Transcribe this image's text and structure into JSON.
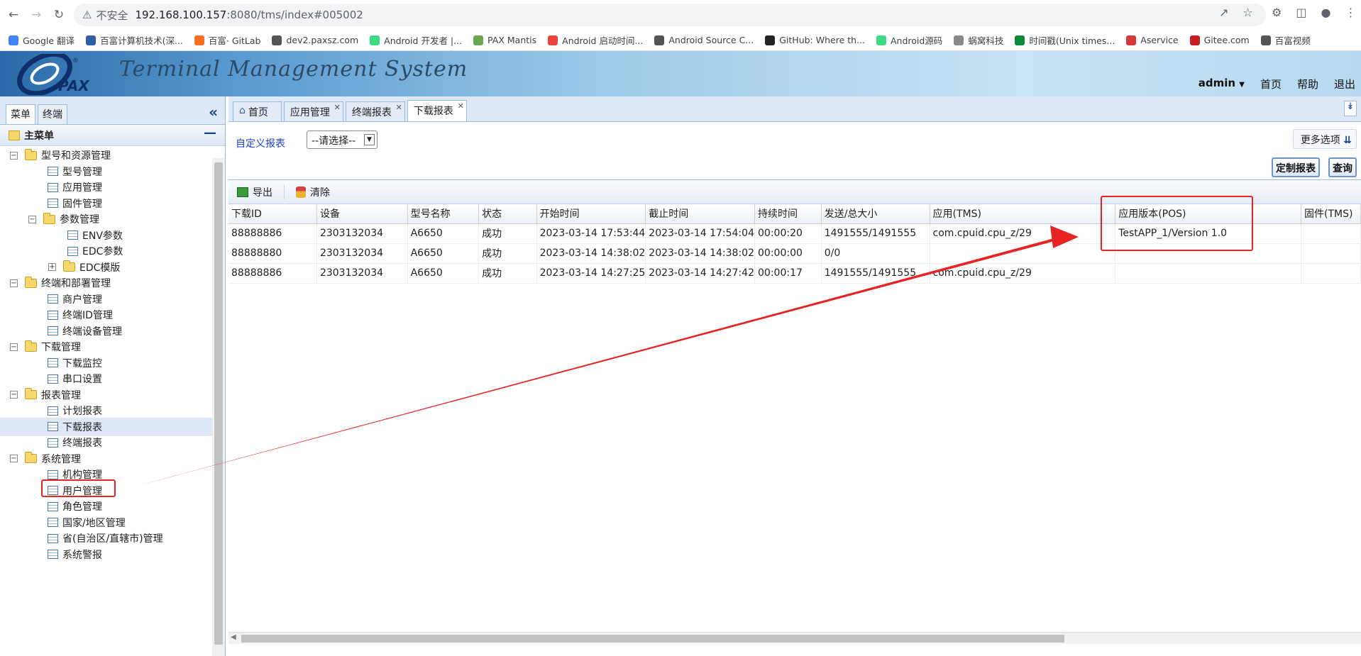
{
  "browser": {
    "url_security": "不安全",
    "url_host": "192.168.100.157",
    "url_path": ":8080/tms/index#005002",
    "bookmarks": [
      {
        "label": "Google 翻译",
        "color": "#4285f4"
      },
      {
        "label": "百富计算机技术(深...",
        "color": "#2c5fa8"
      },
      {
        "label": "百富· GitLab",
        "color": "#fc6d26"
      },
      {
        "label": "dev2.paxsz.com",
        "color": "#555555"
      },
      {
        "label": "Android 开发者 |...",
        "color": "#3ddc84"
      },
      {
        "label": "PAX Mantis",
        "color": "#6aa84f"
      },
      {
        "label": "Android 启动时间...",
        "color": "#e8453c"
      },
      {
        "label": "Android Source C...",
        "color": "#555555"
      },
      {
        "label": "GitHub: Where th...",
        "color": "#222222"
      },
      {
        "label": "Android源码",
        "color": "#3ddc84"
      },
      {
        "label": "蜗窝科技",
        "color": "#888888"
      },
      {
        "label": "时间戳(Unix times...",
        "color": "#0a8a3a"
      },
      {
        "label": "Aservice",
        "color": "#d23a3a"
      },
      {
        "label": "Gitee.com",
        "color": "#c71d23"
      },
      {
        "label": "百富视频",
        "color": "#555555"
      }
    ]
  },
  "app": {
    "title": "Terminal Management System",
    "logo_text": "PAX",
    "user": "admin",
    "links": {
      "home": "首页",
      "help": "帮助",
      "logout": "退出"
    }
  },
  "sidebar": {
    "tab_menu": "菜单",
    "tab_terminal": "终端",
    "main_menu": "主菜单",
    "tree": [
      {
        "label": "型号和资源管理",
        "type": "folder",
        "level": 0
      },
      {
        "label": "型号管理",
        "type": "leaf",
        "level": 1
      },
      {
        "label": "应用管理",
        "type": "leaf",
        "level": 1
      },
      {
        "label": "固件管理",
        "type": "leaf",
        "level": 1
      },
      {
        "label": "参数管理",
        "type": "folder",
        "level": 1
      },
      {
        "label": "ENV参数",
        "type": "leaf",
        "level": 2
      },
      {
        "label": "EDC参数",
        "type": "leaf",
        "level": 2
      },
      {
        "label": "EDC模版",
        "type": "folder",
        "level": 2
      },
      {
        "label": "终端和部署管理",
        "type": "folder",
        "level": 0
      },
      {
        "label": "商户管理",
        "type": "leaf",
        "level": 1
      },
      {
        "label": "终端ID管理",
        "type": "leaf",
        "level": 1
      },
      {
        "label": "终端设备管理",
        "type": "leaf",
        "level": 1
      },
      {
        "label": "下载管理",
        "type": "folder",
        "level": 0
      },
      {
        "label": "下载监控",
        "type": "leaf",
        "level": 1
      },
      {
        "label": "串口设置",
        "type": "leaf",
        "level": 1
      },
      {
        "label": "报表管理",
        "type": "folder",
        "level": 0
      },
      {
        "label": "计划报表",
        "type": "leaf",
        "level": 1
      },
      {
        "label": "下载报表",
        "type": "leaf",
        "level": 1,
        "selected": true
      },
      {
        "label": "终端报表",
        "type": "leaf",
        "level": 1
      },
      {
        "label": "系统管理",
        "type": "folder",
        "level": 0
      },
      {
        "label": "机构管理",
        "type": "leaf",
        "level": 1
      },
      {
        "label": "用户管理",
        "type": "leaf",
        "level": 1
      },
      {
        "label": "角色管理",
        "type": "leaf",
        "level": 1
      },
      {
        "label": "国家/地区管理",
        "type": "leaf",
        "level": 1
      },
      {
        "label": "省(自治区/直辖市)管理",
        "type": "leaf",
        "level": 1
      },
      {
        "label": "系统警报",
        "type": "leaf",
        "level": 1
      }
    ]
  },
  "tabs": [
    {
      "label": "首页",
      "closable": false
    },
    {
      "label": "应用管理",
      "closable": true
    },
    {
      "label": "终端报表",
      "closable": true
    },
    {
      "label": "下载报表",
      "closable": true,
      "active": true
    }
  ],
  "query": {
    "custom_report_link": "自定义报表",
    "select_value": "--请选择--",
    "more_options": "更多选项",
    "custom_btn": "定制报表",
    "query_btn": "查询"
  },
  "toolbar": {
    "export": "导出",
    "clear": "清除"
  },
  "table": {
    "columns": [
      "下载ID",
      "设备",
      "型号名称",
      "状态",
      "开始时间",
      "截止时间",
      "持续时间",
      "发送/总大小",
      "应用(TMS)",
      "应用版本(POS)",
      "固件(TMS)"
    ],
    "rows": [
      [
        "88888886",
        "2303132034",
        "A6650",
        "成功",
        "2023-03-14 17:53:44",
        "2023-03-14 17:54:04",
        "00:00:20",
        "1491555/1491555",
        "com.cpuid.cpu_z/29",
        "TestAPP_1/Version 1.0",
        ""
      ],
      [
        "88888880",
        "2303132034",
        "A6650",
        "成功",
        "2023-03-14 14:38:02",
        "2023-03-14 14:38:02",
        "00:00:00",
        "0/0",
        "",
        "",
        ""
      ],
      [
        "88888886",
        "2303132034",
        "A6650",
        "成功",
        "2023-03-14 14:27:25",
        "2023-03-14 14:27:42",
        "00:00:17",
        "1491555/1491555",
        "com.cpuid.cpu_z/29",
        "",
        ""
      ]
    ]
  },
  "annotation_color": "#e82323"
}
